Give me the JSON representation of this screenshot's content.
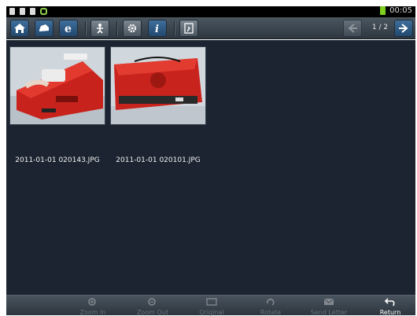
{
  "status_bar": {
    "time": "00:05",
    "icons": [
      "settings-icon",
      "sd-card-icon",
      "lock-icon",
      "android-icon",
      "battery-icon"
    ]
  },
  "toolbar": {
    "buttons": [
      {
        "name": "home",
        "icon": "home-icon"
      },
      {
        "name": "car",
        "icon": "car-icon"
      },
      {
        "name": "browser",
        "icon": "browser-icon"
      },
      {
        "name": "person",
        "icon": "person-icon"
      },
      {
        "name": "settings",
        "icon": "gear-icon"
      },
      {
        "name": "info",
        "icon": "info-icon"
      },
      {
        "name": "exit",
        "icon": "exit-icon"
      }
    ],
    "page_indicator": "1 / 2",
    "accent": "#2f5f8e"
  },
  "gallery": {
    "images": [
      {
        "filename": "2011-01-01 020143.JPG",
        "thumb_subject": "red device with cable"
      },
      {
        "filename": "2011-01-01 020101.JPG",
        "thumb_subject": "red device case"
      }
    ]
  },
  "bottom_bar": {
    "buttons": [
      {
        "label": "Zoom In",
        "enabled": false,
        "icon": "zoom-in-icon"
      },
      {
        "label": "Zoom Out",
        "enabled": false,
        "icon": "zoom-out-icon"
      },
      {
        "label": "Original",
        "enabled": false,
        "icon": "original-icon"
      },
      {
        "label": "Rotate",
        "enabled": false,
        "icon": "rotate-icon"
      },
      {
        "label": "Send Letter",
        "enabled": false,
        "icon": "send-letter-icon"
      },
      {
        "label": "Return",
        "enabled": true,
        "icon": "return-icon"
      }
    ]
  }
}
